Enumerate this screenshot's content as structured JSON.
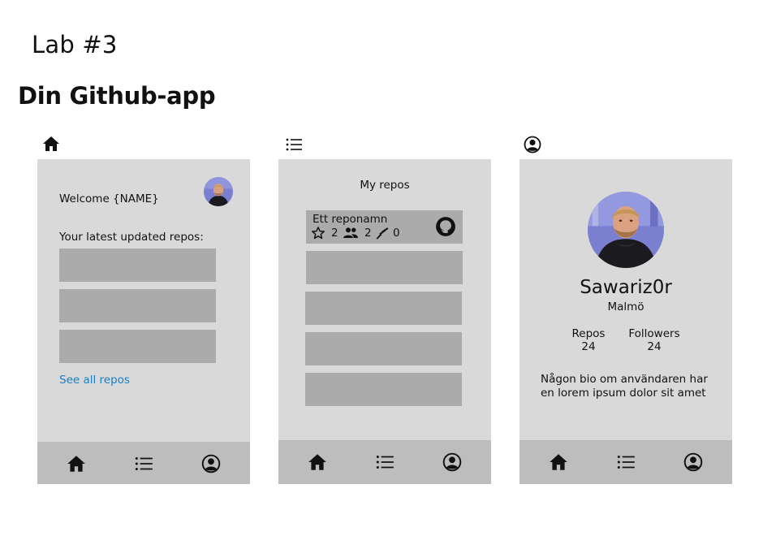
{
  "page": {
    "lab_title": "Lab #3",
    "main_title": "Din Github-app"
  },
  "screens": {
    "home": {
      "header_icon": "home-icon",
      "welcome": "Welcome {NAME}",
      "latest_label": "Your latest updated repos:",
      "see_all": "See all repos"
    },
    "repos": {
      "header_icon": "list-icon",
      "title": "My repos",
      "first_repo": {
        "name": "Ett reponamn",
        "stars": "2",
        "contributors": "2",
        "forks": "0"
      }
    },
    "profile": {
      "header_icon": "user-circle-icon",
      "username": "Sawariz0r",
      "location": "Malmö",
      "repos_label": "Repos",
      "repos_value": "24",
      "followers_label": "Followers",
      "followers_value": "24",
      "bio": "Någon bio om användaren har en lorem ipsum dolor sit amet"
    }
  },
  "navbar": {
    "icons": [
      "home-icon",
      "list-icon",
      "user-circle-icon"
    ]
  },
  "colors": {
    "phone_bg": "#d9d9d9",
    "navbar_bg": "#bdbdbd",
    "placeholder": "#ababab",
    "link": "#1a7fc1"
  }
}
